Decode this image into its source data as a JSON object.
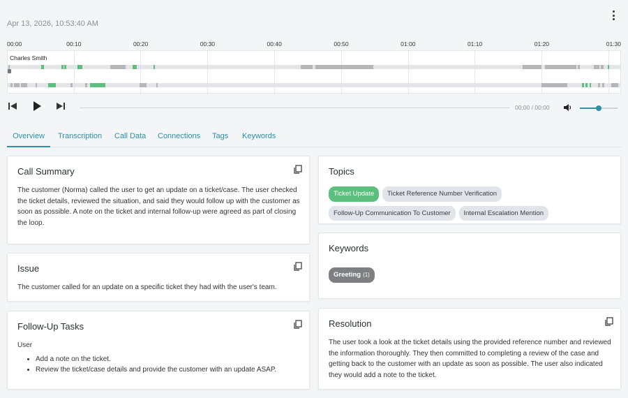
{
  "header": {
    "timestamp": "Apr 13, 2026, 10:53:40 AM",
    "menu_icon": "kebab-menu-icon"
  },
  "timeline": {
    "ticks": [
      "00:00",
      "00:10",
      "00:20",
      "00:30",
      "00:40",
      "00:50",
      "01:00",
      "01:10",
      "01:20",
      "01:30"
    ],
    "speaker_label": "Charles Smith"
  },
  "player": {
    "prev_icon": "skip-previous-icon",
    "play_icon": "play-icon",
    "next_icon": "skip-next-icon",
    "time_readout": "00:00 / 00:00",
    "volume_icon": "volume-icon",
    "volume_level": 0.5
  },
  "tabs": [
    {
      "label": "Overview",
      "active": true
    },
    {
      "label": "Transcription"
    },
    {
      "label": "Call Data"
    },
    {
      "label": "Connections"
    },
    {
      "label": "Tags"
    },
    {
      "label": "Keywords"
    }
  ],
  "cards": {
    "call_summary": {
      "title": "Call Summary",
      "body": "The customer (Norma) called the user to get an update on a ticket/case. The user checked the ticket details, reviewed the situation, and said they would follow up with the customer as soon as possible. A note on the ticket and internal follow-up were agreed as part of closing the loop."
    },
    "issue": {
      "title": "Issue",
      "body": "The customer called for an update on a specific ticket they had with the user's team."
    },
    "follow_up": {
      "title": "Follow-Up Tasks",
      "assignee": "User",
      "tasks": [
        "Add a note on the ticket.",
        "Review the ticket/case details and provide the customer with an update ASAP."
      ]
    },
    "topics": {
      "title": "Topics",
      "chips": [
        "Ticket Update",
        "Ticket Reference Number Verification",
        "Follow-Up Communication To Customer",
        "Internal Escalation Mention"
      ]
    },
    "keywords": {
      "title": "Keywords",
      "chip_label": "Greeting",
      "chip_count": "(1)"
    },
    "resolution": {
      "title": "Resolution",
      "body": "The user took a look at the ticket details using the provided reference number and reviewed the information thoroughly. They then committed to completing a review of the case and getting back to the customer with an update as soon as possible. The user also indicated they would add a note to the ticket."
    }
  },
  "colors": {
    "accent": "#2f8fa3",
    "speech_green": "#5cbf7e",
    "speech_grey": "#b4b6b9"
  }
}
